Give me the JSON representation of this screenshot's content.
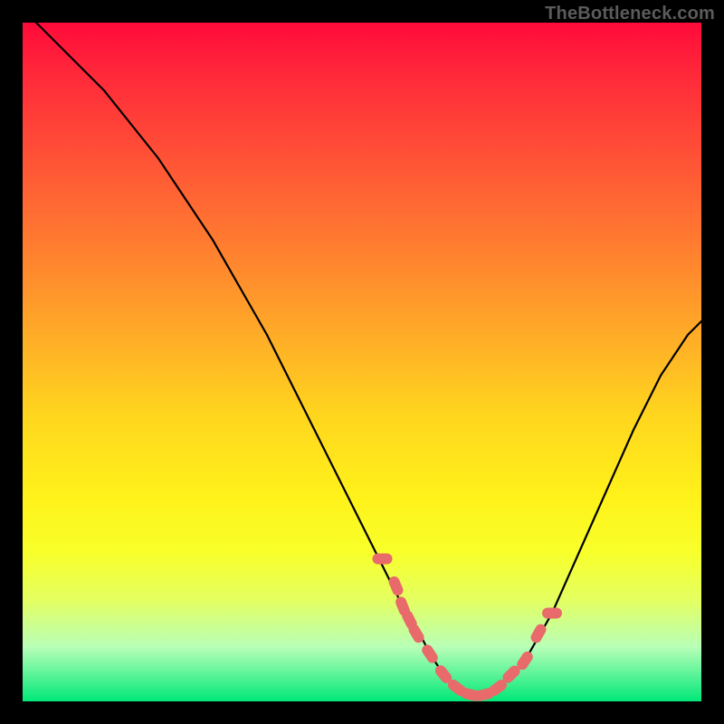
{
  "watermark": "TheBottleneck.com",
  "colors": {
    "background": "#000000",
    "curve": "#000000",
    "marker": "#e86a6a",
    "markerStroke": "#c94f4f"
  },
  "chart_data": {
    "type": "line",
    "title": "",
    "xlabel": "",
    "ylabel": "",
    "xlim": [
      0,
      100
    ],
    "ylim": [
      0,
      100
    ],
    "grid": false,
    "legend": false,
    "series": [
      {
        "name": "bottleneck-curve",
        "x": [
          0,
          4,
          8,
          12,
          16,
          20,
          24,
          28,
          32,
          36,
          40,
          44,
          48,
          52,
          56,
          58,
          60,
          62,
          64,
          66,
          68,
          70,
          74,
          78,
          82,
          86,
          90,
          94,
          98,
          100
        ],
        "y": [
          102,
          98,
          94,
          90,
          85,
          80,
          74,
          68,
          61,
          54,
          46,
          38,
          30,
          22,
          14,
          11,
          7,
          4,
          2,
          1,
          1,
          2,
          6,
          13,
          22,
          31,
          40,
          48,
          54,
          56
        ]
      }
    ],
    "markers": {
      "name": "highlight-points",
      "x": [
        53,
        55,
        56,
        57,
        58,
        60,
        62,
        64,
        66,
        68,
        70,
        72,
        74,
        76,
        78
      ],
      "y": [
        21,
        17,
        14,
        12,
        10,
        7,
        4,
        2,
        1,
        1,
        2,
        4,
        6,
        10,
        13
      ]
    }
  }
}
